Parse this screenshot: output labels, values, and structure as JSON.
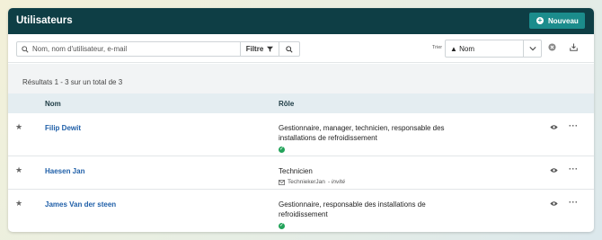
{
  "header": {
    "title": "Utilisateurs",
    "new_button": "Nouveau"
  },
  "toolbar": {
    "search_placeholder": "Nom, nom d'utilisateur, e-mail",
    "filter_label": "Filtre",
    "sort_label": "Trier",
    "sort_value": "Nom",
    "sort_direction": "ascending"
  },
  "results": {
    "summary": "Résultats 1 - 3 sur un total de 3"
  },
  "table": {
    "columns": [
      "Nom",
      "Rôle"
    ],
    "rows": [
      {
        "name": "Filip Dewit",
        "role_line1": "Gestionnaire, manager, technicien, responsable des",
        "role_line2": "installations de refroidissement",
        "verified": true
      },
      {
        "name": "Haesen Jan",
        "role_line1": "Technicien",
        "invite_user": "TechniekerJan",
        "invite_status": "- invité"
      },
      {
        "name": "James Van der steen",
        "role_line1": "Gestionnaire, responsable des installations de",
        "role_line2": "refroidissement",
        "verified": true
      }
    ]
  },
  "colors": {
    "header_bg": "#0e3e45",
    "accent": "#1b8c8c",
    "link": "#1f5fa8",
    "success": "#23a35a"
  }
}
